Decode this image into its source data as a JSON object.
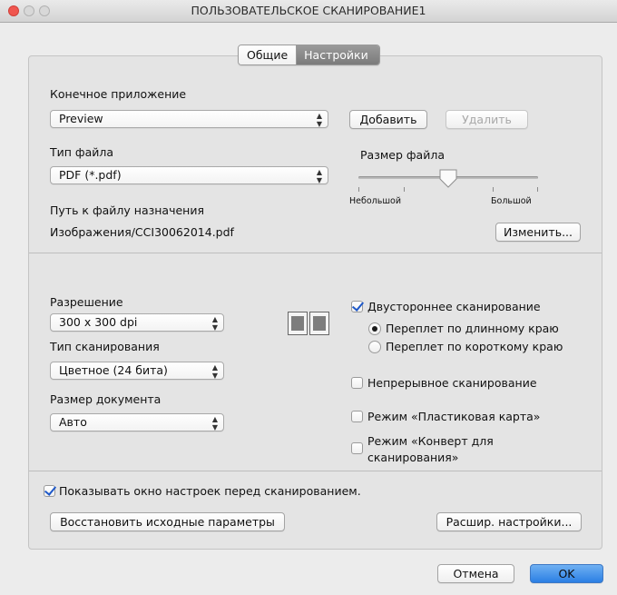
{
  "window": {
    "title": "ПОЛЬЗОВАТЕЛЬСКОЕ СКАНИРОВАНИЕ1"
  },
  "tabs": [
    {
      "label": "Общие"
    },
    {
      "label": "Настройки"
    }
  ],
  "target_app": {
    "label": "Конечное приложение",
    "value": "Preview",
    "add_button": "Добавить",
    "remove_button": "Удалить"
  },
  "file_type": {
    "label": "Тип файла",
    "value": "PDF (*.pdf)"
  },
  "file_size": {
    "label": "Размер файла",
    "min_label": "Небольшой",
    "max_label": "Большой",
    "level": 0.5
  },
  "dest_path": {
    "label": "Путь к файлу назначения",
    "value": "Изображения/CCI30062014.pdf",
    "change_button": "Изменить..."
  },
  "resolution": {
    "label": "Разрешение",
    "value": "300 x 300  dpi"
  },
  "scan_type": {
    "label": "Тип сканирования",
    "value": "Цветное (24 бита)"
  },
  "doc_size": {
    "label": "Размер документа",
    "value": "Авто"
  },
  "duplex": {
    "label": "Двустороннее сканирование",
    "checked": true,
    "long_edge": "Переплет по длинному краю",
    "short_edge": "Переплет по короткому краю",
    "selected": "long_edge"
  },
  "continuous": {
    "label": "Непрерывное сканирование",
    "checked": false
  },
  "plastic_card": {
    "label": "Режим «Пластиковая карта»",
    "checked": false
  },
  "envelope": {
    "label_line1": "Режим «Конверт для",
    "label_line2": "сканирования»",
    "checked": false
  },
  "show_settings": {
    "label": "Показывать окно настроек перед сканированием.",
    "checked": true
  },
  "restore_button": "Восстановить исходные параметры",
  "advanced_button": "Расшир. настройки...",
  "cancel_button": "Отмена",
  "ok_button": "OK",
  "colors": {
    "accent": "#2b7fe4",
    "close": "#f0564f",
    "selected_tab": "#8a8a8a"
  }
}
